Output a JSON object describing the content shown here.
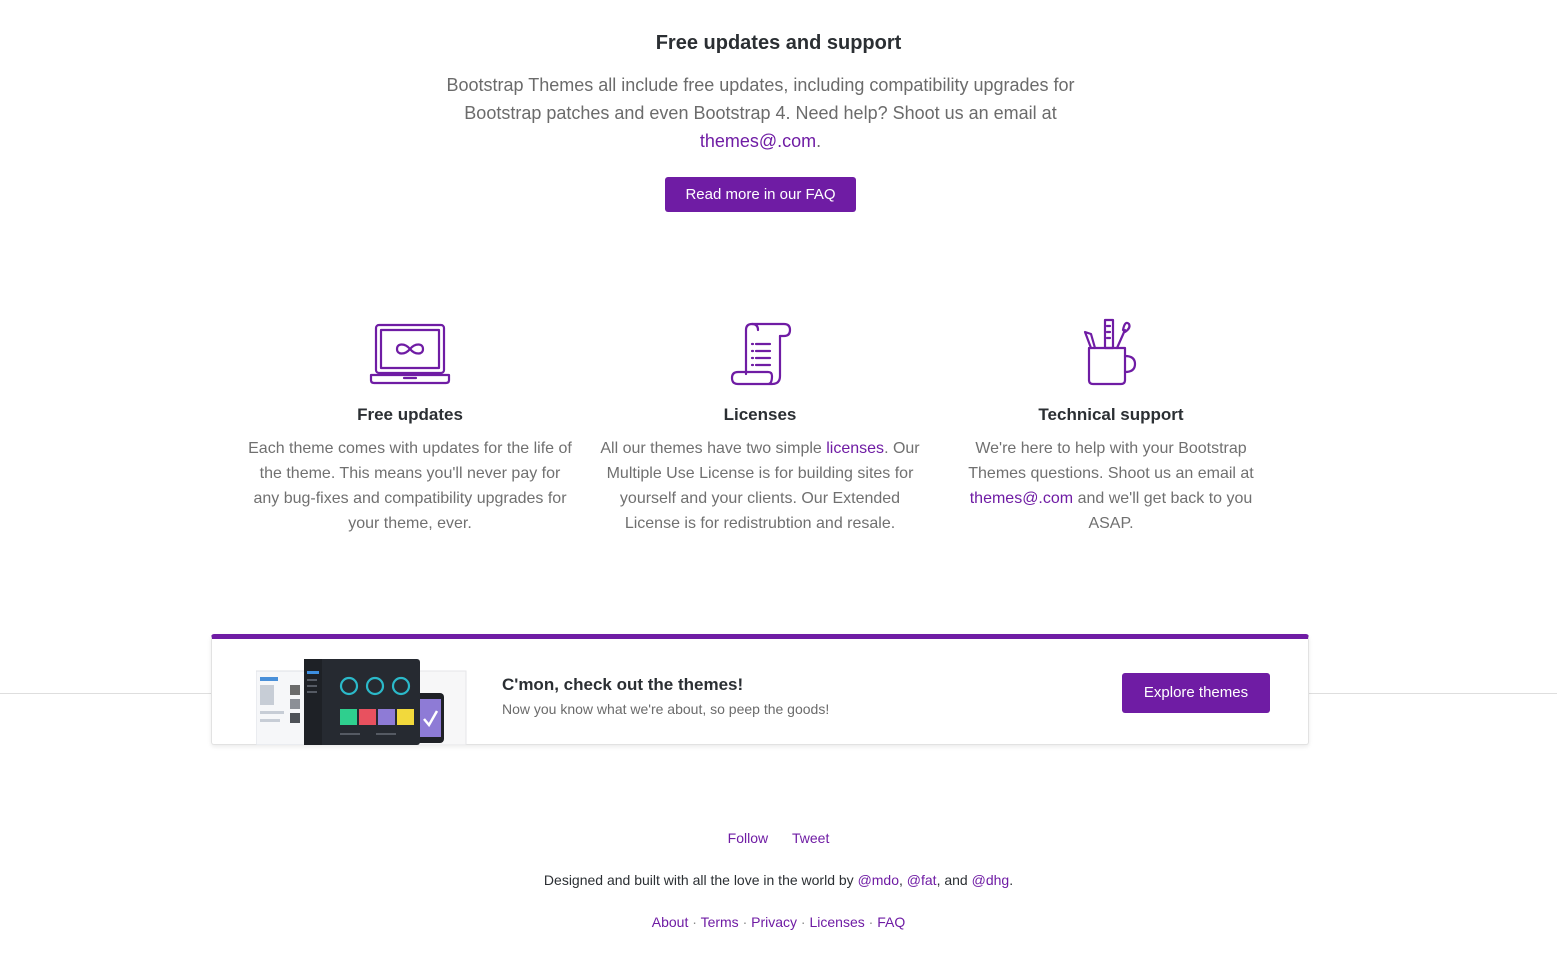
{
  "support": {
    "title": "Free updates and support",
    "body_text": "Bootstrap Themes all include free updates, including compatibility upgrades for Bootstrap patches and even Bootstrap 4. Need help? Shoot us an email at",
    "email": "themes@.com",
    "period": ".",
    "faq_button": "Read more in our FAQ"
  },
  "features": [
    {
      "icon": "laptop-infinity-icon",
      "title": "Free updates",
      "text": "Each theme comes with updates for the life of the theme. This means you'll never pay for any bug-fixes and compatibility upgrades for your theme, ever."
    },
    {
      "icon": "scroll-document-icon",
      "title": "Licenses",
      "text_before": "All our themes have two simple",
      "link": "licenses",
      "text_after": ". Our Multiple Use License is for building sites for yourself and your clients. Our Extended License is for redistrubtion and resale."
    },
    {
      "icon": "pencil-cup-icon",
      "title": "Technical support",
      "text_before": "We're here to help with your Bootstrap Themes questions. Shoot us an email at",
      "link": "themes@.com",
      "text_after": "and we'll get back to you ASAP."
    }
  ],
  "cta": {
    "title": "C'mon, check out the themes!",
    "subtitle": "Now you know what we're about, so peep the goods!",
    "button": "Explore themes"
  },
  "footer": {
    "social": [
      "Follow",
      "Tweet"
    ],
    "credit_text": "Designed and built with all the love in the world by",
    "authors": [
      "@mdo",
      "@fat",
      "@dhg"
    ],
    "links": [
      "About",
      "Terms",
      "Privacy",
      "Licenses",
      "FAQ"
    ]
  },
  "colors": {
    "accent": "#6f1ca4",
    "heading": "#2b2f33",
    "text": "#6b6b6b"
  }
}
